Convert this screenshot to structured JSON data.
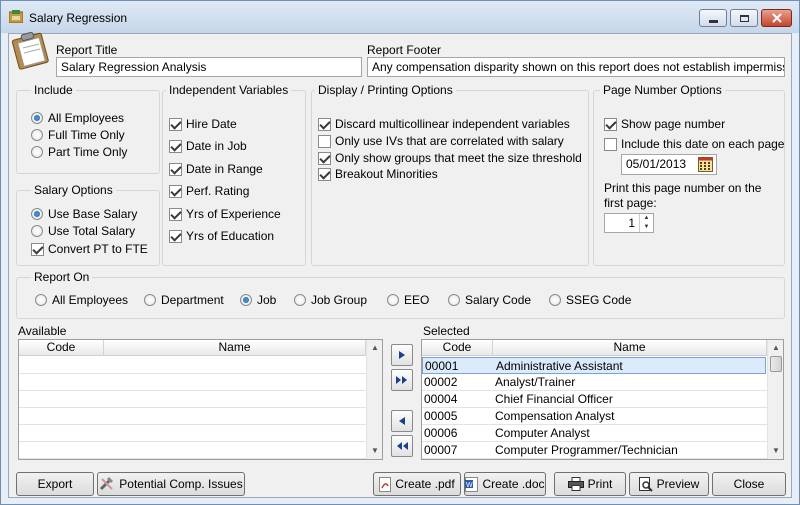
{
  "window": {
    "title": "Salary Regression"
  },
  "report_title": {
    "label": "Report Title",
    "value": "Salary Regression Analysis"
  },
  "report_footer": {
    "label": "Report Footer",
    "value": "Any compensation disparity shown on this report does not establish impermissi"
  },
  "include": {
    "title": "Include",
    "options": [
      "All Employees",
      "Full Time Only",
      "Part Time Only"
    ],
    "selected": "All Employees"
  },
  "salary_options": {
    "title": "Salary Options",
    "options": [
      "Use Base Salary",
      "Use Total Salary"
    ],
    "selected": "Use Base Salary",
    "convert_label": "Convert PT to FTE",
    "convert_checked": true
  },
  "independent_variables": {
    "title": "Independent Variables",
    "items": [
      {
        "label": "Hire Date",
        "checked": true
      },
      {
        "label": "Date in Job",
        "checked": true
      },
      {
        "label": "Date in Range",
        "checked": true
      },
      {
        "label": "Perf. Rating",
        "checked": true
      },
      {
        "label": "Yrs of Experience",
        "checked": true
      },
      {
        "label": "Yrs of Education",
        "checked": true
      }
    ]
  },
  "display": {
    "title": "Display / Printing Options",
    "items": [
      {
        "label": "Discard multicollinear independent variables",
        "checked": true
      },
      {
        "label": "Only use IVs that are correlated with salary",
        "checked": false
      },
      {
        "label": "Only show groups that meet the size threshold",
        "checked": true
      },
      {
        "label": "Breakout Minorities",
        "checked": true
      }
    ]
  },
  "page_number": {
    "title": "Page Number Options",
    "show_label": "Show page number",
    "show_checked": true,
    "include_date_label": "Include this date on each page",
    "include_date_checked": false,
    "date_value": "05/01/2013",
    "first_page_label_line1": "Print this page number on the",
    "first_page_label_line2": "first page:",
    "first_page_value": "1"
  },
  "report_on": {
    "title": "Report On",
    "options": [
      "All Employees",
      "Department",
      "Job",
      "Job Group",
      "EEO",
      "Salary Code",
      "SSEG Code"
    ],
    "selected": "Job"
  },
  "available": {
    "label": "Available",
    "columns": [
      "Code",
      "Name"
    ],
    "rows": []
  },
  "selected": {
    "label": "Selected",
    "columns": [
      "Code",
      "Name"
    ],
    "rows": [
      {
        "code": "00001",
        "name": "Administrative Assistant"
      },
      {
        "code": "00002",
        "name": "Analyst/Trainer"
      },
      {
        "code": "00004",
        "name": "Chief Financial Officer"
      },
      {
        "code": "00005",
        "name": "Compensation Analyst"
      },
      {
        "code": "00006",
        "name": "Computer Analyst"
      },
      {
        "code": "00007",
        "name": "Computer Programmer/Technician"
      }
    ],
    "selected_index": 0
  },
  "buttons": {
    "export": "Export",
    "potential": "Potential Comp. Issues",
    "create_pdf": "Create .pdf",
    "create_doc": "Create .doc",
    "print": "Print",
    "preview": "Preview",
    "close": "Close"
  },
  "colors": {
    "selection": "#dcebfc",
    "accent_blue": "#1a3f8f"
  }
}
